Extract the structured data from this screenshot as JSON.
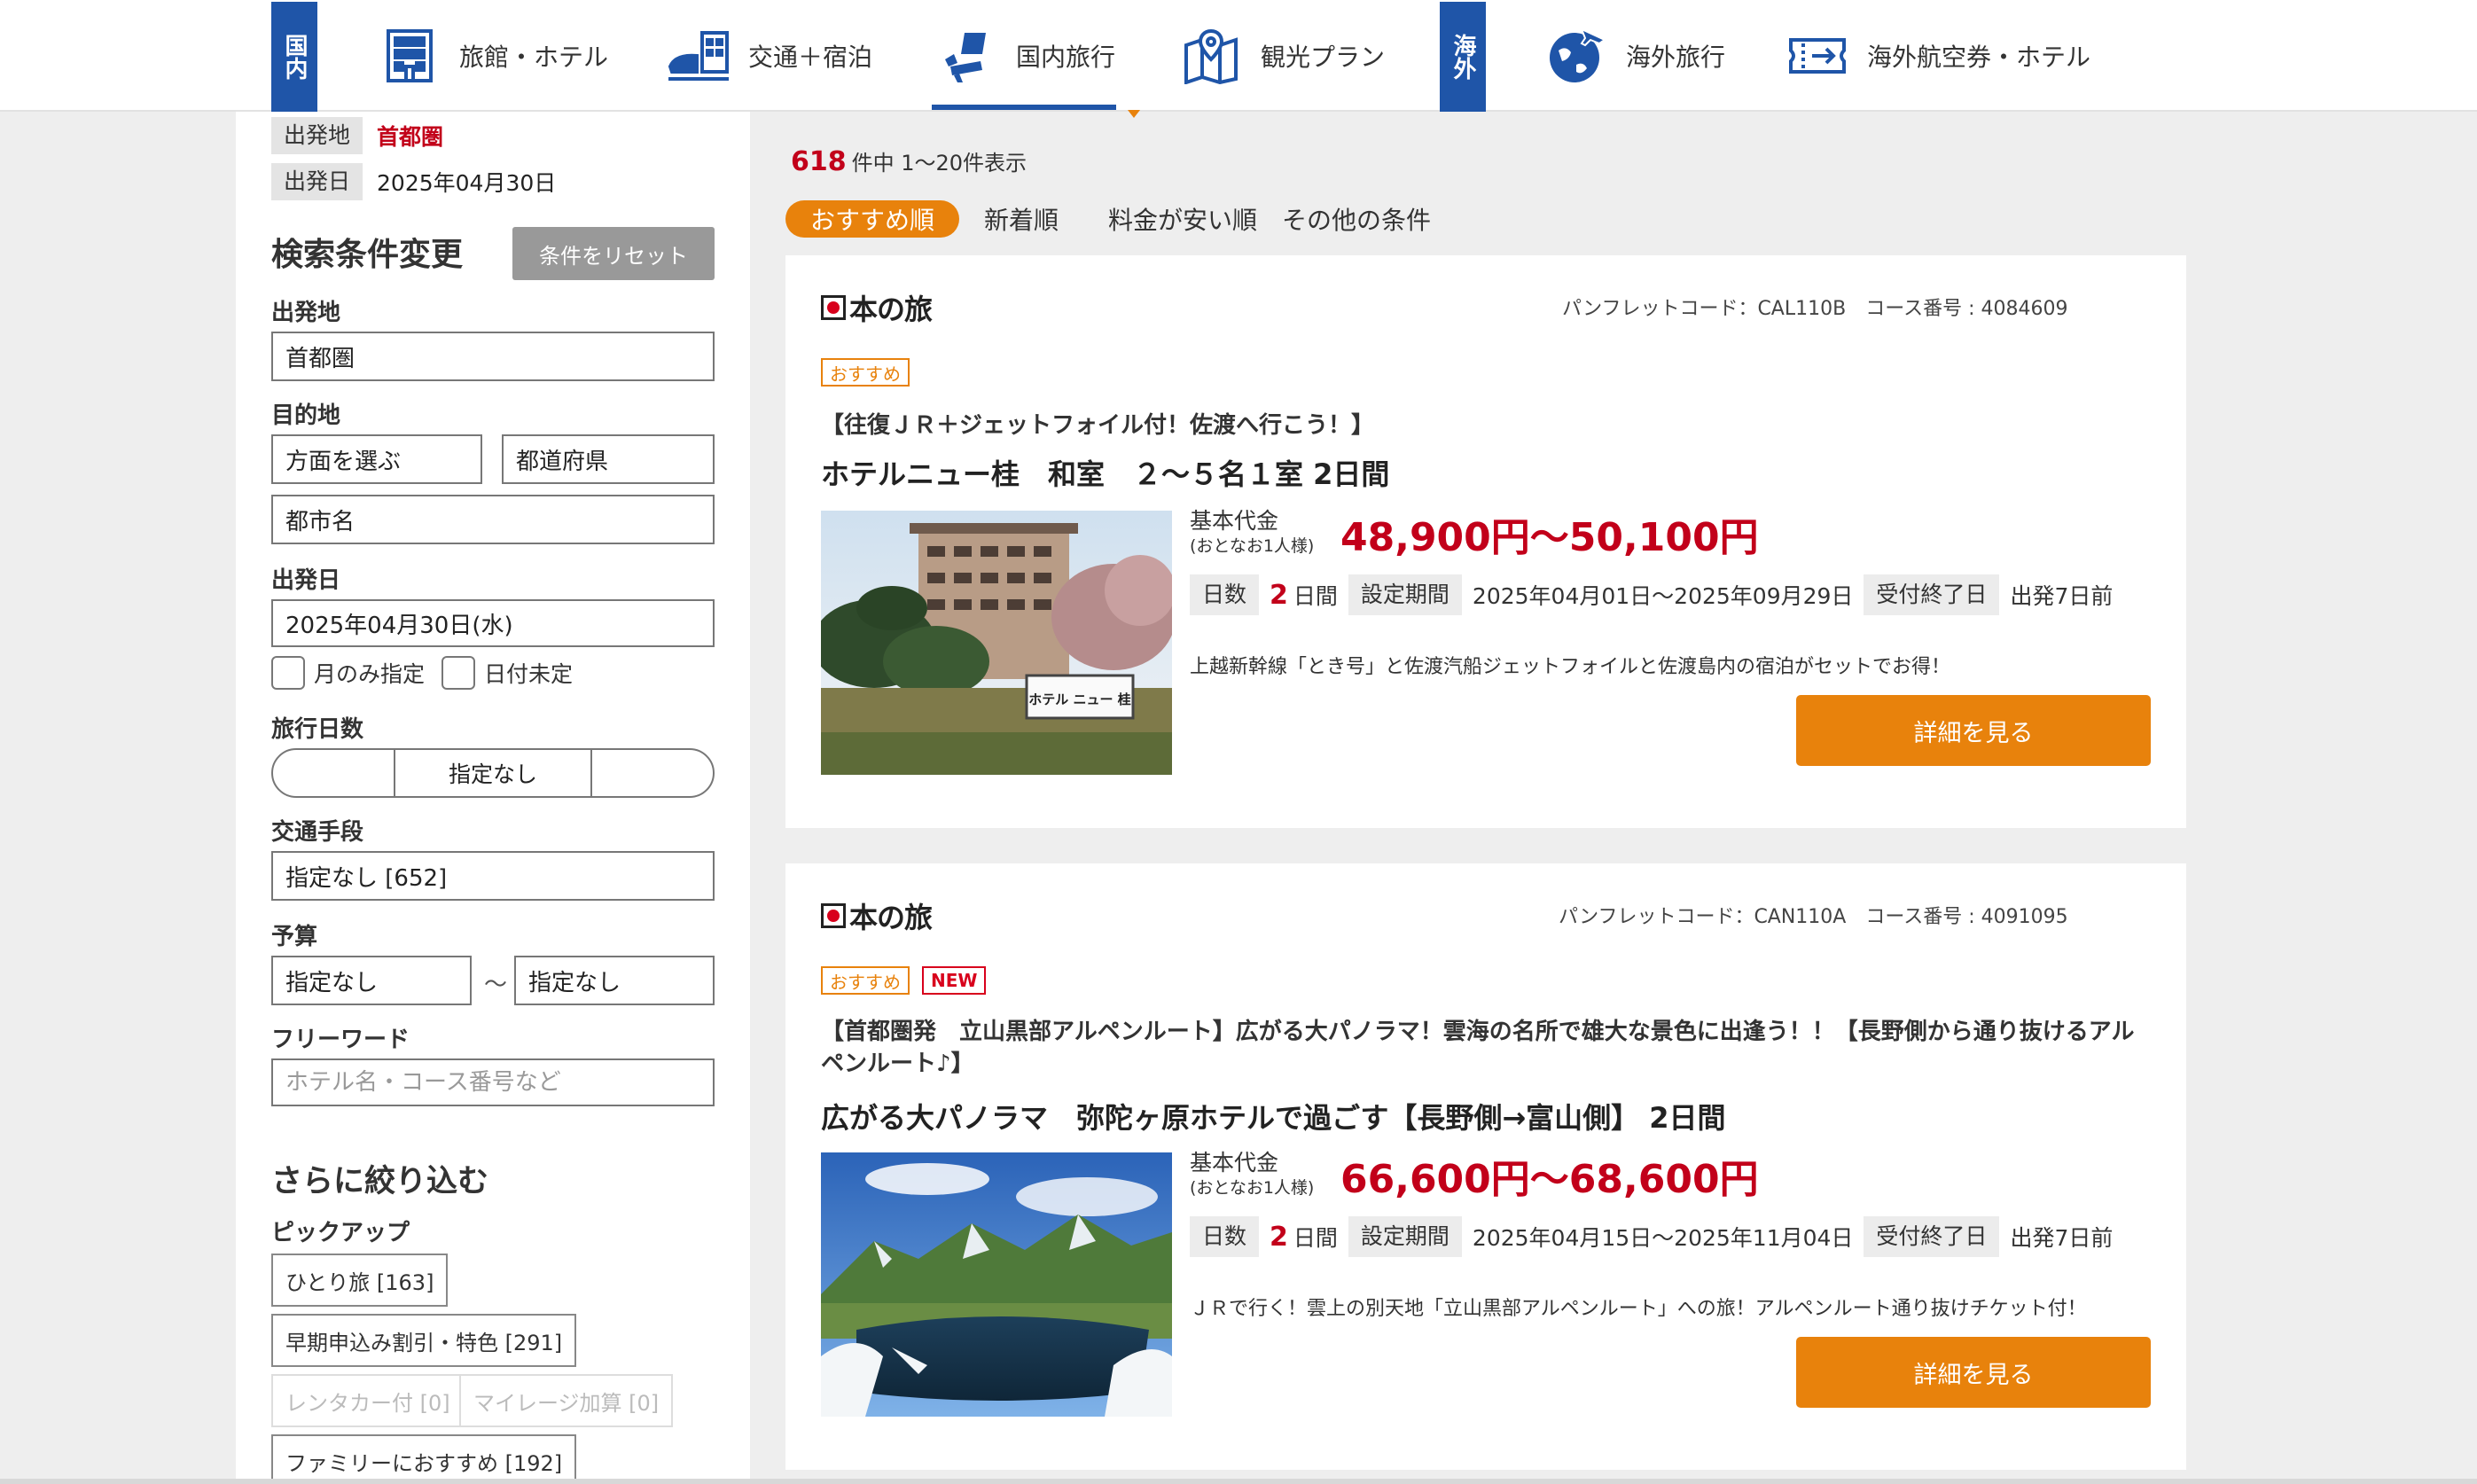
{
  "nav": {
    "domestic_tag": "国内",
    "overseas_tag": "海外",
    "items": [
      {
        "label": "旅館・ホテル",
        "icon": "building-icon"
      },
      {
        "label": "交通＋宿泊",
        "icon": "train-hotel-icon"
      },
      {
        "label": "国内旅行",
        "icon": "airplane-seat-icon"
      },
      {
        "label": "観光プラン",
        "icon": "map-pin-icon"
      },
      {
        "label": "海外旅行",
        "icon": "globe-plane-icon"
      },
      {
        "label": "海外航空券・ホテル",
        "icon": "ticket-icon"
      }
    ],
    "active_index": 2
  },
  "current": {
    "departure_tag": "出発地",
    "departure_value": "首都圏",
    "date_tag": "出発日",
    "date_value": "2025年04月30日"
  },
  "search": {
    "heading": "検索条件変更",
    "reset_label": "条件をリセット",
    "departure_label": "出発地",
    "departure_value": "首都圏",
    "destination_label": "目的地",
    "area_value": "方面を選ぶ",
    "pref_value": "都道府県",
    "city_value": "都市名",
    "date_label": "出発日",
    "date_value": "2025年04月30日(水)",
    "month_only_label": "月のみ指定",
    "date_undecided_label": "日付未定",
    "days_label": "旅行日数",
    "days_left": "",
    "days_value": "指定なし",
    "days_right": "",
    "transport_label": "交通手段",
    "transport_value": "指定なし [652]",
    "budget_label": "予算",
    "budget_min": "指定なし",
    "budget_tilde": "～",
    "budget_max": "指定なし",
    "freeword_label": "フリーワード",
    "freeword_placeholder": "ホテル名・コース番号など"
  },
  "refine": {
    "heading": "さらに絞り込む",
    "pickup_label": "ピックアップ",
    "items": [
      {
        "label": "ひとり旅 [163]",
        "disabled": false
      },
      {
        "label": "早期申込み割引・特色 [291]",
        "disabled": false
      },
      {
        "label": "レンタカー付 [0]",
        "disabled": true
      },
      {
        "label": "マイレージ加算 [0]",
        "disabled": true
      },
      {
        "label": "ファミリーにおすすめ [192]",
        "disabled": false
      }
    ]
  },
  "results": {
    "count": "618",
    "count_suffix": "件中 1〜20件表示",
    "sort_tabs": [
      "おすすめ順",
      "新着順",
      "料金が安い順",
      "その他の条件"
    ],
    "active_sort": 0
  },
  "brand_logo_text": "本の旅",
  "cards": [
    {
      "pamphlet": "パンフレットコード：CAL110B　コース番号 : 4084609",
      "badges": [
        "おすすめ"
      ],
      "subtitle": "【往復ＪＲ＋ジェットフォイル付！佐渡へ行こう！】",
      "title": "ホテルニュー桂　和室　２～５名１室 2日間",
      "price_label": "基本代金",
      "price_sub": "(おとなお1人様)",
      "price": "48,900円〜50,100円",
      "days_key": "日数",
      "days_num": "2",
      "days_unit": "日間",
      "period_key": "設定期間",
      "period": "2025年04月01日〜2025年09月29日",
      "deadline_key": "受付終了日",
      "deadline": "出発7日前",
      "desc": "上越新幹線「とき号」と佐渡汽船ジェットフォイルと佐渡島内の宿泊がセットでお得！",
      "button": "詳細を見る",
      "sign_text": "ホテル ニュー 桂"
    },
    {
      "pamphlet": "パンフレットコード：CAN110A　コース番号 : 4091095",
      "badges": [
        "おすすめ",
        "NEW"
      ],
      "subtitle": "【首都圏発　立山黒部アルペンルート】広がる大パノラマ！雲海の名所で雄大な景色に出逢う！！【長野側から通り抜けるアルペンルート♪】",
      "title": "広がる大パノラマ　弥陀ヶ原ホテルで過ごす【長野側→富山側】 2日間",
      "price_label": "基本代金",
      "price_sub": "(おとなお1人様)",
      "price": "66,600円〜68,600円",
      "days_key": "日数",
      "days_num": "2",
      "days_unit": "日間",
      "period_key": "設定期間",
      "period": "2025年04月15日〜2025年11月04日",
      "deadline_key": "受付終了日",
      "deadline": "出発7日前",
      "desc": "ＪＲで行く！雲上の別天地「立山黒部アルペンルート」への旅！アルペンルート通り抜けチケット付！",
      "button": "詳細を見る"
    }
  ],
  "colors": {
    "nav_blue": "#1f55a8",
    "accent_orange": "#e8820c",
    "price_red": "#c2001a",
    "new_red": "#d8001c"
  }
}
